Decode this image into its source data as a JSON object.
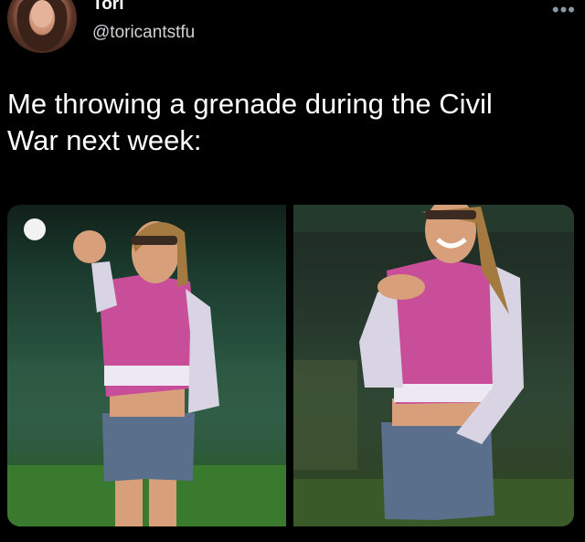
{
  "author": {
    "display_name": "Tori",
    "handle": "@toricantstfu"
  },
  "more_icon": "•••",
  "tweet": {
    "text_line1": "Me throwing a grenade during the Civil",
    "text_line2": "War next week:"
  },
  "colors": {
    "background": "#000000",
    "text": "#ffffff",
    "secondary_text": "#d0d3d6",
    "jacket_pink": "#c84e9a",
    "jacket_sleeve": "#d8d4e4",
    "denim": "#5a6f8c"
  }
}
